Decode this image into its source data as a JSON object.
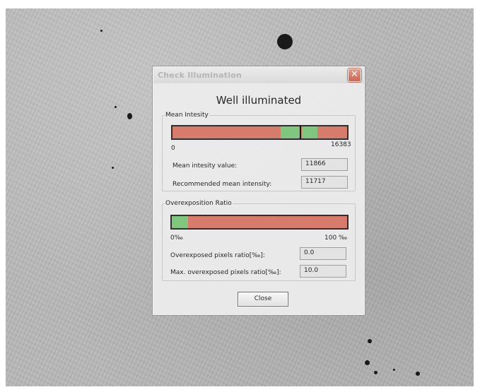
{
  "dialog": {
    "title": "Check Illumination",
    "close_glyph": "✕",
    "status": "Well illuminated",
    "close_button": "Close"
  },
  "mean_intensity": {
    "legend": "Mean Intesity",
    "scale_min": "0",
    "scale_max": "16383",
    "mean_label": "Mean intesity value:",
    "mean_value": "11866",
    "recommended_label": "Recommended mean intensity:",
    "recommended_value": "11717"
  },
  "overexposition": {
    "legend": "Overexposition Ratio",
    "scale_min": "0‰",
    "scale_max": "100 ‰",
    "ratio_label": "Overexposed pixels ratio[‰]:",
    "ratio_value": "0.0",
    "max_label": "Max. overexposed pixels ratio[‰]:",
    "max_value": "10.0"
  },
  "colors": {
    "bar_fill": "#d9796a",
    "acceptable_zone": "#7ec77d",
    "close_button_red": "#d1624e"
  },
  "icons": {
    "title_close": "close-icon"
  }
}
